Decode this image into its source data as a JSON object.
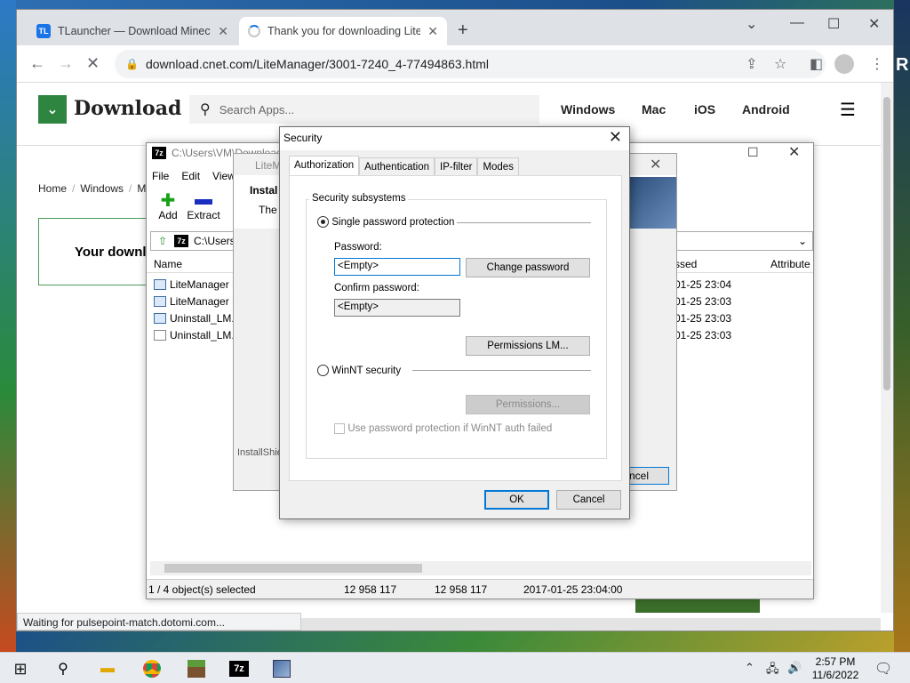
{
  "browser": {
    "tabs": [
      {
        "label": "TLauncher — Download Minecraft",
        "favicon": "TL"
      },
      {
        "label": "Thank you for downloading LiteManager"
      }
    ],
    "new_tab": "+",
    "url": "download.cnet.com/LiteManager/3001-7240_4-77494863.html",
    "status": "Waiting for pulsepoint-match.dotomi.com..."
  },
  "cnet": {
    "logo": "Download",
    "search_placeholder": "Search Apps...",
    "nav": [
      "Windows",
      "Mac",
      "iOS",
      "Android"
    ],
    "breadcrumb": [
      "Home",
      "Windows",
      "M"
    ],
    "download_box": "Your downl",
    "desktop_edge_text": "R"
  },
  "zip": {
    "title": "C:\\Users\\VM\\Downloads",
    "menu": [
      "File",
      "Edit",
      "View"
    ],
    "tools": [
      {
        "label": "Add"
      },
      {
        "label": "Extract"
      }
    ],
    "path": "C:\\Users",
    "columns": {
      "name": "Name",
      "accessed": "ssed",
      "attributes": "Attribute"
    },
    "files": [
      {
        "name": "LiteManager P",
        "date": "01-25 23:04"
      },
      {
        "name": "LiteManager P",
        "date": "01-25 23:03"
      },
      {
        "name": "Uninstall_LM.e",
        "date": "01-25 23:03"
      },
      {
        "name": "Uninstall_LM.t",
        "date": "01-25 23:03"
      }
    ],
    "status": {
      "selected": "1 / 4 object(s) selected",
      "size": "12 958 117",
      "packed": "12 958 117",
      "modified": "2017-01-25 23:04:00"
    }
  },
  "installer": {
    "title": "LiteM",
    "heading": "Instal",
    "sub": "The p",
    "footer": "InstallShie",
    "cancel": "ncel"
  },
  "security": {
    "title": "Security",
    "tabs": [
      "Authorization",
      "Authentication",
      "IP-filter",
      "Modes"
    ],
    "group_label": "Security subsystems",
    "single_password": "Single password protection",
    "password_label": "Password:",
    "password_value": "<Empty>",
    "change_password": "Change password",
    "confirm_label": "Confirm password:",
    "confirm_value": "<Empty>",
    "permissions_lm": "Permissions LM...",
    "winnt": "WinNT security",
    "permissions": "Permissions...",
    "use_password": "Use password protection if WinNT auth failed",
    "ok": "OK",
    "cancel": "Cancel"
  },
  "taskbar": {
    "time": "2:57 PM",
    "date": "11/6/2022",
    "apps": [
      "file-explorer",
      "chrome",
      "minecraft",
      "7zip",
      "installer"
    ]
  }
}
